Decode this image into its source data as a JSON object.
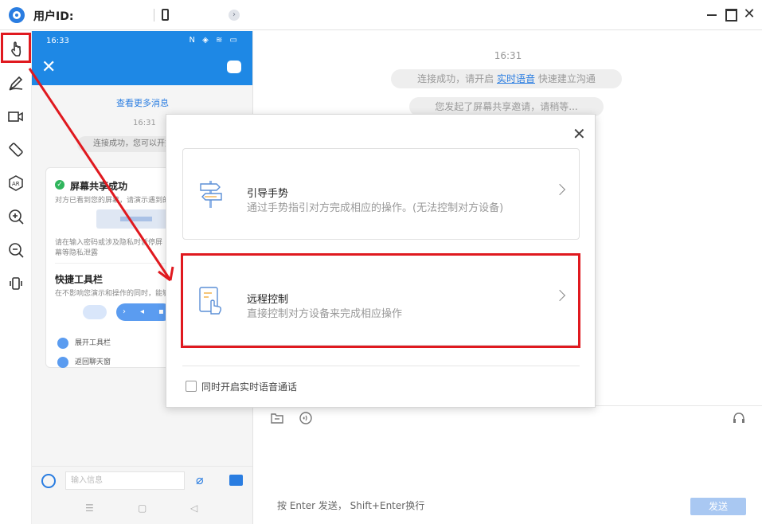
{
  "titlebar": {
    "uid_label": "用户ID:",
    "icons": [
      "app-logo",
      "phone-icon",
      "expand-icon"
    ],
    "window_controls": [
      "minimize",
      "maximize",
      "close"
    ]
  },
  "toolbar": {
    "tools": [
      "gesture-hand-icon",
      "pen-icon",
      "video-icon",
      "rotate-icon",
      "ar-icon",
      "zoom-in-icon",
      "zoom-out-icon",
      "vibrate-icon"
    ],
    "selected": "gesture-hand-icon",
    "highlight_color": "#e0191f"
  },
  "phone": {
    "status_time": "16:33",
    "more_messages": "查看更多消息",
    "chat_time": "16:31",
    "system_msg": "连接成功，您可以开始与",
    "card": {
      "title": "屏幕共享成功",
      "subtitle": "对方已看到您的屏幕，请演示遇到的",
      "warning": "请在输入密码或涉及隐私时暂停屏幕等隐私泄露",
      "section_title": "快捷工具栏",
      "section_sub": "在不影响您演示和操作的同时，能够",
      "item1": "展开工具栏",
      "item2": "返回聊天窗"
    },
    "input_placeholder": "输入信息",
    "nav": [
      "☰",
      "▢",
      "◁"
    ]
  },
  "chat": {
    "time": "16:31",
    "sys1_prefix": "连接成功，请开启",
    "sys1_link": "实时语音",
    "sys1_suffix": "快速建立沟通",
    "sys2": "您发起了屏幕共享邀请，请稍等...",
    "hint": "按 Enter 发送， Shift+Enter换行",
    "send_label": "发送"
  },
  "modal": {
    "close_glyph": "✕",
    "option1": {
      "title": "引导手势",
      "desc": "通过手势指引对方完成相应的操作。(无法控制对方设备)",
      "icon": "signpost-icon"
    },
    "option2": {
      "title": "远程控制",
      "desc": "直接控制对方设备来完成相应操作",
      "icon": "remote-control-icon"
    },
    "checkbox_label": "同时开启实时语音通话",
    "checkbox_checked": false
  },
  "colors": {
    "accent": "#1e88e5",
    "annotation_red": "#e0191f",
    "send_disabled": "#a9c8f2"
  }
}
